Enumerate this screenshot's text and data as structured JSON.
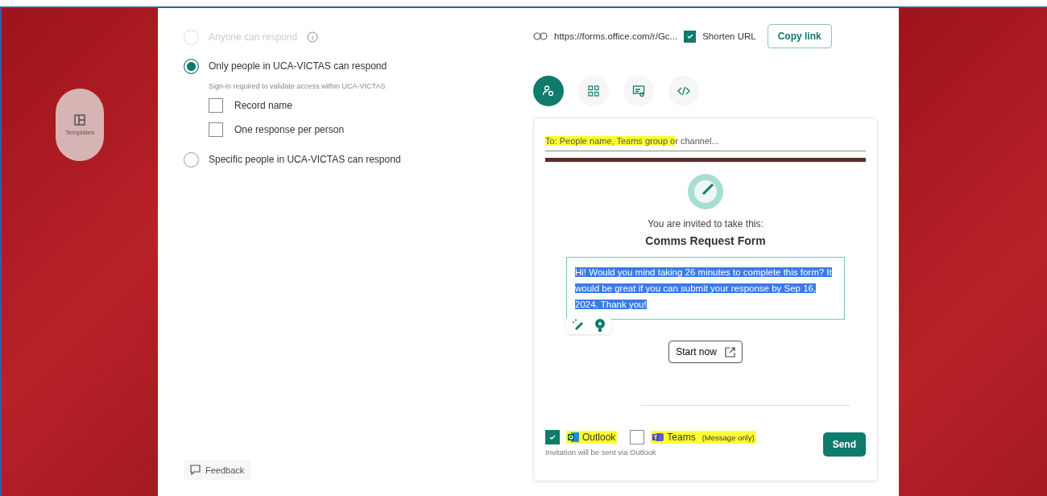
{
  "sidebar": {
    "templates_button": {
      "label": "Templates"
    }
  },
  "response_options": [
    {
      "label": "Anyone can respond",
      "selected": false,
      "disabled": true,
      "info": true
    },
    {
      "label": "Only people in UCA-VICTAS can respond",
      "selected": true,
      "disabled": false,
      "info": false,
      "note": "Sign-in required to validate access within UCA-VICTAS",
      "checkboxes": [
        {
          "label": "Record name",
          "checked": false
        },
        {
          "label": "One response per person",
          "checked": false
        }
      ]
    },
    {
      "label": "Specific people in UCA-VICTAS can respond",
      "selected": false,
      "disabled": false,
      "info": false
    }
  ],
  "feedback": {
    "label": "Feedback"
  },
  "link_bar": {
    "url": "https://forms.office.com/r/Gc...",
    "shorten": {
      "label": "Shorten URL",
      "checked": true
    },
    "copy_button": "Copy link"
  },
  "share_tabs": [
    {
      "kind": "invite",
      "selected": true
    },
    {
      "kind": "qr",
      "selected": false
    },
    {
      "kind": "present",
      "selected": false
    },
    {
      "kind": "embed",
      "selected": false
    }
  ],
  "invite": {
    "to_field": {
      "highlighted_text": "To: People name, Teams group o",
      "text": "r channel..."
    },
    "invited_text": "You are invited to take this:",
    "form_title": "Comms Request Form",
    "message": {
      "text": "Hi! Would you mind taking 26 minutes to complete this form? It would be great if you can submit your response by Sep 16, 2024. Thank you!",
      "selected": true
    },
    "start_button": "Start now",
    "channels": [
      {
        "kind": "outlook",
        "label": "Outlook",
        "checked": true,
        "highlighted": true
      },
      {
        "kind": "teams",
        "label": "Teams",
        "note": "(Message only)",
        "checked": false,
        "highlighted": true
      }
    ],
    "status_text": "Invitation will be sent via Outlook",
    "send_button": "Send"
  }
}
